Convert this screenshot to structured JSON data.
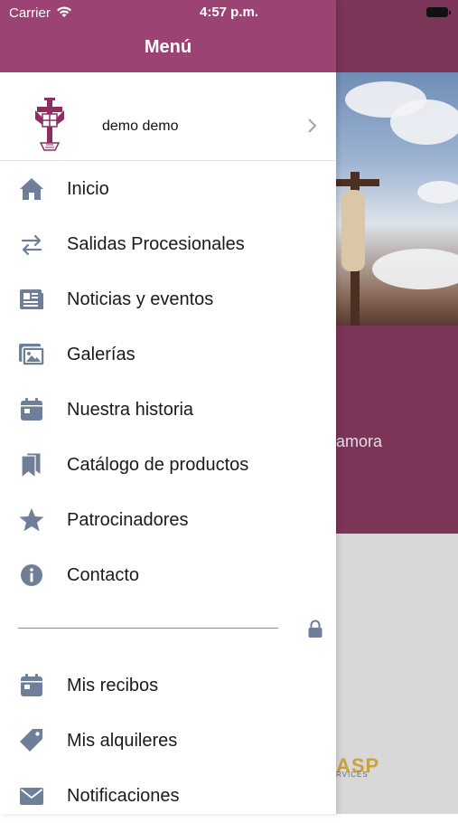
{
  "status_bar": {
    "carrier": "Carrier",
    "time": "4:57 p.m."
  },
  "drawer": {
    "title": "Menú",
    "profile": {
      "name": "demo demo"
    },
    "menu": [
      {
        "label": "Inicio",
        "icon": "home-icon"
      },
      {
        "label": "Salidas Procesionales",
        "icon": "swap-arrows-icon"
      },
      {
        "label": "Noticias y eventos",
        "icon": "newspaper-icon"
      },
      {
        "label": "Galerías",
        "icon": "gallery-icon"
      },
      {
        "label": "Nuestra historia",
        "icon": "calendar-icon"
      },
      {
        "label": "Catálogo de productos",
        "icon": "bookmarks-icon"
      },
      {
        "label": "Patrocinadores",
        "icon": "star-icon"
      },
      {
        "label": "Contacto",
        "icon": "info-icon"
      }
    ],
    "user_menu": [
      {
        "label": "Mis recibos",
        "icon": "calendar-icon"
      },
      {
        "label": "Mis alquileres",
        "icon": "tag-icon"
      },
      {
        "label": "Notificaciones",
        "icon": "envelope-icon"
      }
    ]
  },
  "background": {
    "partial_text": "amora",
    "logo_text": "ASP",
    "logo_subtext": "RVICES"
  },
  "colors": {
    "header": "#9b4373",
    "background_purple": "#7a3558",
    "icon": "#6f7f99"
  }
}
